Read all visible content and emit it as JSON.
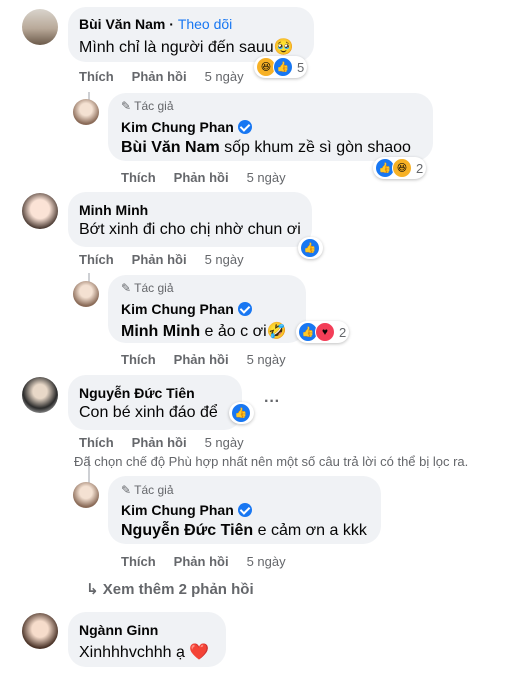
{
  "comments": [
    {
      "author": "Bùi Văn Nam",
      "follow": "Theo dõi",
      "text": "Mình chỉ là người đến sauu🥹",
      "actions": {
        "like": "Thích",
        "reply": "Phản hồi",
        "time": "5 ngày"
      },
      "reaction_count": "5",
      "reactions": [
        "haha",
        "like"
      ]
    },
    {
      "author_tag": "Tác giả",
      "author": "Kim Chung Phan",
      "mention": "Bùi Văn Nam",
      "text": "sốp khum zề sì gòn shaoo",
      "actions": {
        "like": "Thích",
        "reply": "Phản hồi",
        "time": "5 ngày"
      },
      "reaction_count": "2",
      "reactions": [
        "like",
        "haha"
      ]
    },
    {
      "author": "Minh Minh",
      "text": "Bớt xinh đi cho chị nhờ chun ơi",
      "actions": {
        "like": "Thích",
        "reply": "Phản hồi",
        "time": "5 ngày"
      },
      "reactions": [
        "like"
      ]
    },
    {
      "author_tag": "Tác giả",
      "author": "Kim Chung Phan",
      "mention": "Minh Minh",
      "text": "e ảo c ơi🤣",
      "actions": {
        "like": "Thích",
        "reply": "Phản hồi",
        "time": "5 ngày"
      },
      "reaction_count": "2",
      "reactions": [
        "like",
        "love"
      ]
    },
    {
      "author": "Nguyễn Đức Tiên",
      "text": "Con bé xinh đáo để",
      "actions": {
        "like": "Thích",
        "reply": "Phản hồi",
        "time": "5 ngày"
      },
      "reactions": [
        "like"
      ],
      "more": "···"
    },
    {
      "author_tag": "Tác giả",
      "author": "Kim Chung Phan",
      "mention": "Nguyễn Đức Tiên",
      "text": "e cảm ơn a kkk",
      "actions": {
        "like": "Thích",
        "reply": "Phản hồi",
        "time": "5 ngày"
      }
    },
    {
      "author": "Ngànn Ginn",
      "text": "Xinhhhvchhh ạ ❤️"
    }
  ],
  "filter_notice": "Đã chọn chế độ Phù hợp nhất nên một số câu trả lời có thể bị lọc ra.",
  "see_more": "Xem thêm 2 phản hồi",
  "colors": {
    "accent": "#1877f2",
    "bubble": "#f0f2f5",
    "meta": "#65676b"
  }
}
